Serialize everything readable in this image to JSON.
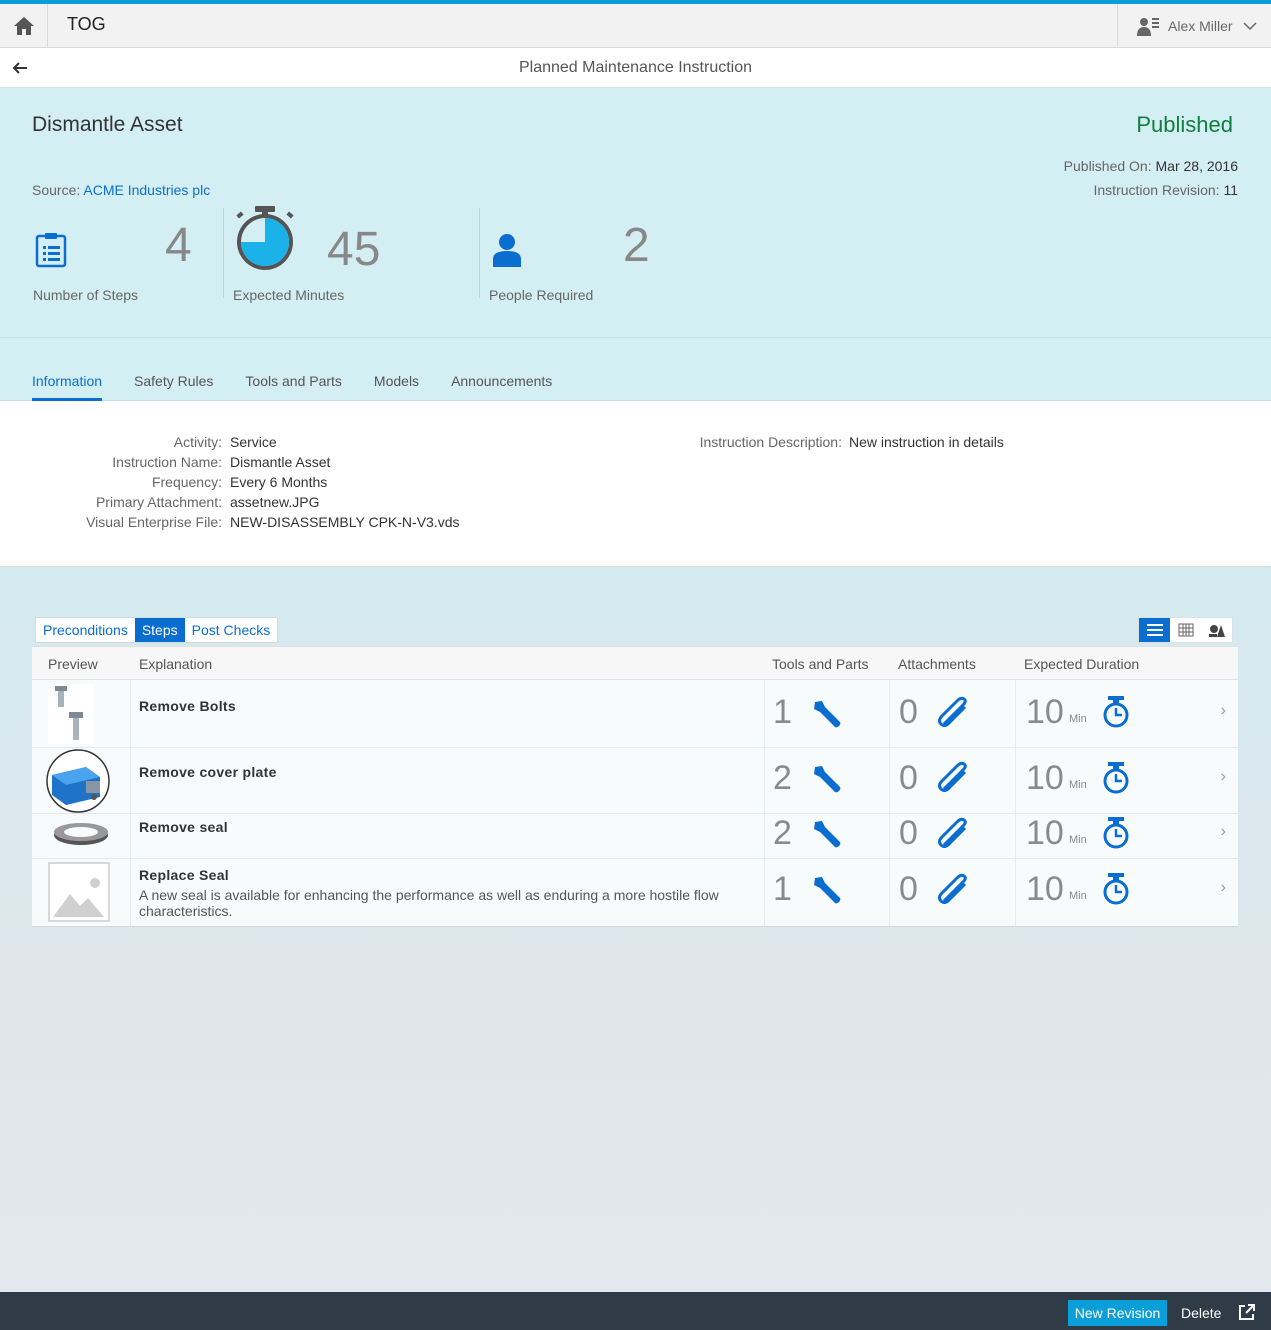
{
  "shell": {
    "app_name": "TOG",
    "user_name": "Alex Miller"
  },
  "page": {
    "title": "Planned Maintenance Instruction"
  },
  "object": {
    "title": "Dismantle Asset",
    "status": "Published",
    "status_color": "#107e3e",
    "published_on_label": "Published On:",
    "published_on": "Mar 28, 2016",
    "revision_label": "Instruction Revision:",
    "revision": "11",
    "source_label": "Source:",
    "source": "ACME Industries plc"
  },
  "kpis": [
    {
      "label": "Number of Steps",
      "value": "4",
      "icon": "clipboard-icon"
    },
    {
      "label": "Expected Minutes",
      "value": "45",
      "icon": "stopwatch-icon",
      "fill_fraction": 0.75
    },
    {
      "label": "People Required",
      "value": "2",
      "icon": "person-icon"
    }
  ],
  "tabs": [
    "Information",
    "Safety Rules",
    "Tools and Parts",
    "Models",
    "Announcements"
  ],
  "active_tab": "Information",
  "info": {
    "activity_label": "Activity:",
    "activity": "Service",
    "name_label": "Instruction Name:",
    "name": "Dismantle Asset",
    "frequency_label": "Frequency:",
    "frequency": "Every 6 Months",
    "attachment_label": "Primary Attachment:",
    "attachment": "assetnew.JPG",
    "ve_file_label": "Visual Enterprise File:",
    "ve_file": "NEW-DISASSEMBLY CPK-N-V3.vds",
    "description_label": "Instruction Description:",
    "description": "New instruction in details"
  },
  "segments": [
    "Preconditions",
    "Steps",
    "Post Checks"
  ],
  "active_segment": "Steps",
  "table": {
    "headers": [
      "Preview",
      "Explanation",
      "Tools and Parts",
      "Attachments",
      "Expected Duration"
    ],
    "rows": [
      {
        "title": "Remove Bolts",
        "description": "",
        "tools": "1",
        "attachments": "0",
        "duration": "10",
        "unit": "Min",
        "preview": "bolts"
      },
      {
        "title": "Remove cover plate",
        "description": "",
        "tools": "2",
        "attachments": "0",
        "duration": "10",
        "unit": "Min",
        "preview": "cover-plate"
      },
      {
        "title": "Remove seal",
        "description": "",
        "tools": "2",
        "attachments": "0",
        "duration": "10",
        "unit": "Min",
        "preview": "seal"
      },
      {
        "title": "Replace Seal",
        "description": "A new seal is available for enhancing the performance as well as enduring a more hostile flow characteristics.",
        "tools": "1",
        "attachments": "0",
        "duration": "10",
        "unit": "Min",
        "preview": "placeholder-image"
      }
    ]
  },
  "footer": {
    "primary": "New Revision",
    "secondary": "Delete"
  },
  "colors": {
    "accent": "#0a6ed1",
    "header_bg": "#d4eff3",
    "footer_bg": "#2f3c47"
  }
}
